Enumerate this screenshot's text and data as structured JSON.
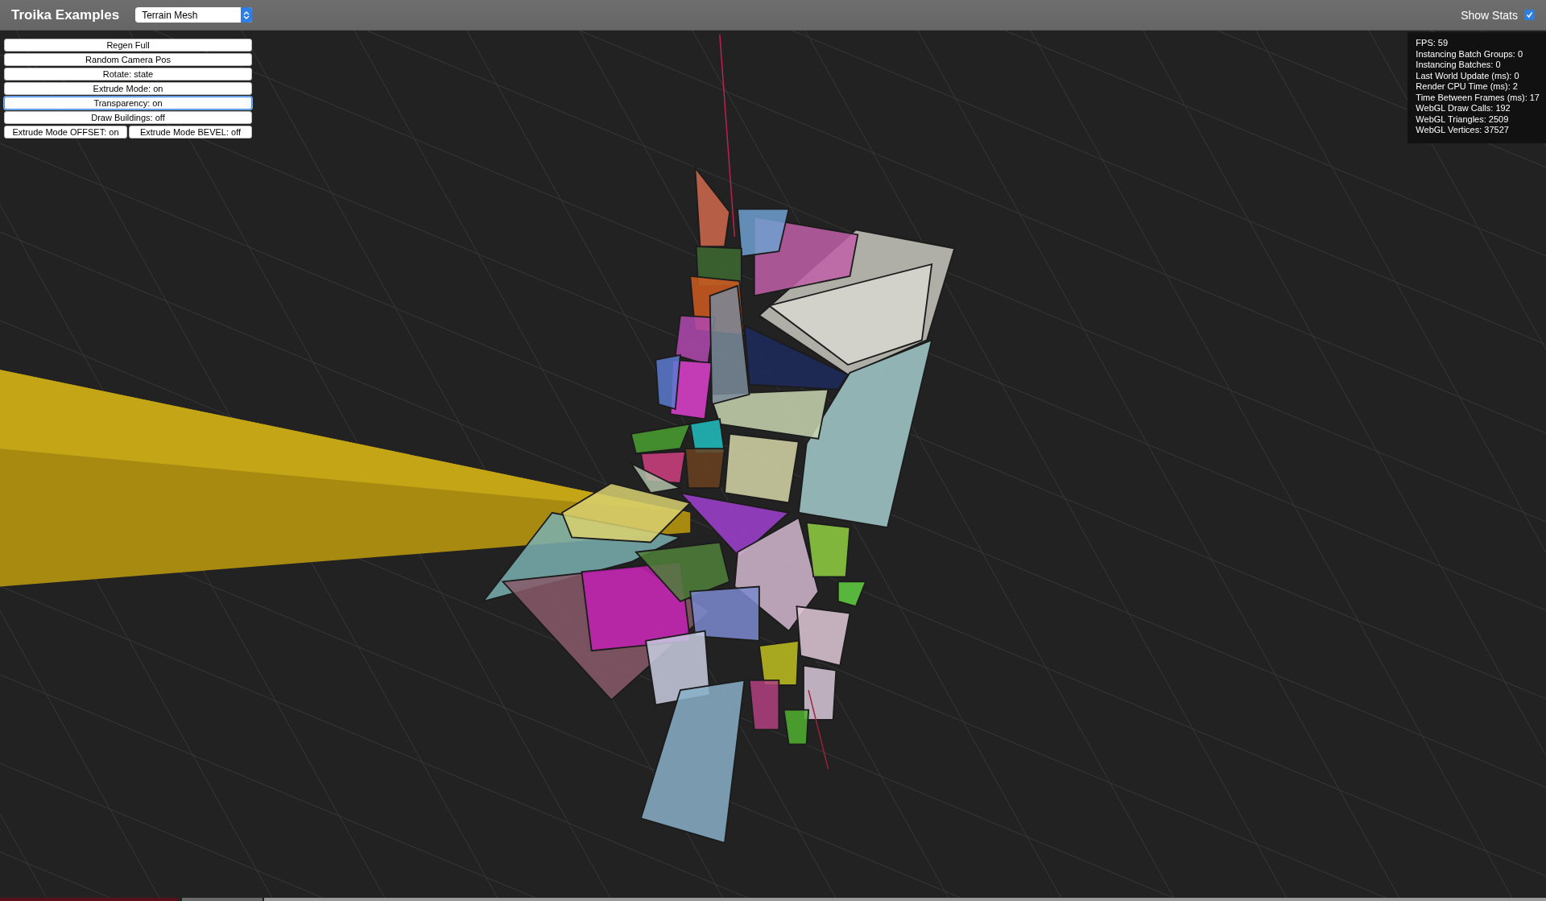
{
  "header": {
    "title": "Troika Examples",
    "example_select": {
      "value": "Terrain Mesh"
    },
    "show_stats": {
      "label": "Show Stats",
      "checked": true
    }
  },
  "control_rows": [
    {
      "buttons": [
        {
          "label": "Regen Full",
          "focused": false
        }
      ]
    },
    {
      "buttons": [
        {
          "label": "Random Camera Pos",
          "focused": false
        }
      ]
    },
    {
      "buttons": [
        {
          "label": "Rotate: state",
          "focused": false
        }
      ]
    },
    {
      "buttons": [
        {
          "label": "Extrude Mode: on",
          "focused": false
        }
      ]
    },
    {
      "buttons": [
        {
          "label": "Transparency: on",
          "focused": true
        }
      ]
    },
    {
      "buttons": [
        {
          "label": "Draw Buildings: off",
          "focused": false
        }
      ]
    },
    {
      "buttons": [
        {
          "label": "Extrude Mode OFFSET: on",
          "focused": false
        },
        {
          "label": "Extrude Mode BEVEL: off",
          "focused": false
        }
      ]
    }
  ],
  "stats": [
    "FPS: 59",
    "Instancing Batch Groups: 0",
    "Instancing Batches: 0",
    "Last World Update (ms): 0",
    "Render CPU Time (ms): 2",
    "Time Between Frames (ms): 17",
    "WebGL Draw Calls: 192",
    "WebGL Triangles: 2509",
    "WebGL Vertices: 37527"
  ]
}
